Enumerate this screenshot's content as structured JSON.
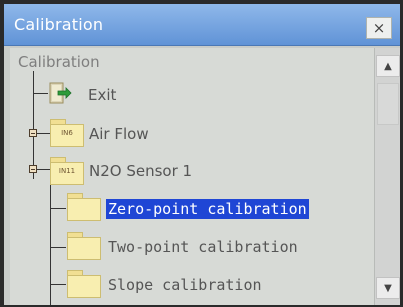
{
  "window": {
    "title": "Calibration",
    "close_label": "×"
  },
  "tree": {
    "root_label": "Calibration",
    "items": [
      {
        "label": "Exit",
        "icon": "exit-icon"
      },
      {
        "label": "Air Flow",
        "folder_label": "IN6"
      },
      {
        "label": "N2O Sensor 1",
        "folder_label": "IN11"
      },
      {
        "label": "Zero-point calibration",
        "selected": true
      },
      {
        "label": "Two-point calibration"
      },
      {
        "label": "Slope calibration"
      }
    ]
  },
  "scrollbar": {
    "up_label": "▲",
    "down_label": "▼"
  }
}
